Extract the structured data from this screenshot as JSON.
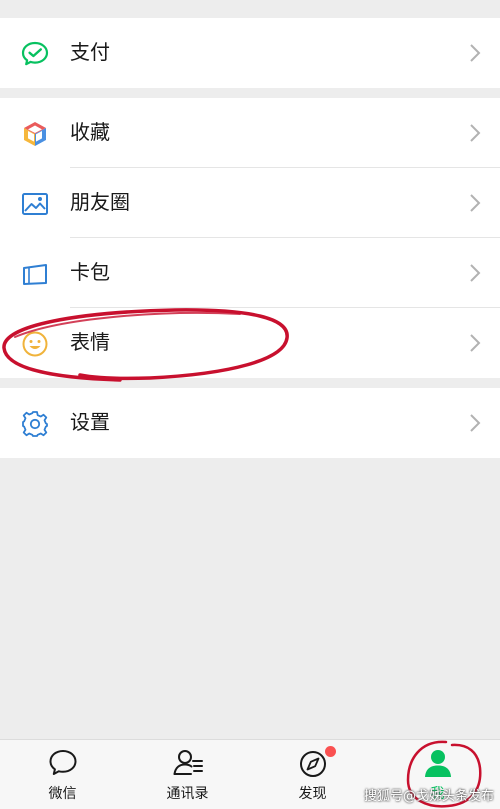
{
  "items": {
    "pay": "支付",
    "favorites": "收藏",
    "moments": "朋友圈",
    "cards": "卡包",
    "stickers": "表情",
    "settings": "设置"
  },
  "tabbar": {
    "chats": "微信",
    "contacts": "通讯录",
    "discover": "发现",
    "me": "我"
  },
  "watermark": "搜狐号@戈姊头条发布",
  "colors": {
    "accent_green": "#07c160",
    "annotation_red": "#c8102e",
    "badge_red": "#fa5151",
    "background": "#ededed"
  },
  "annotations": {
    "circled_items": [
      "表情",
      "我"
    ]
  }
}
